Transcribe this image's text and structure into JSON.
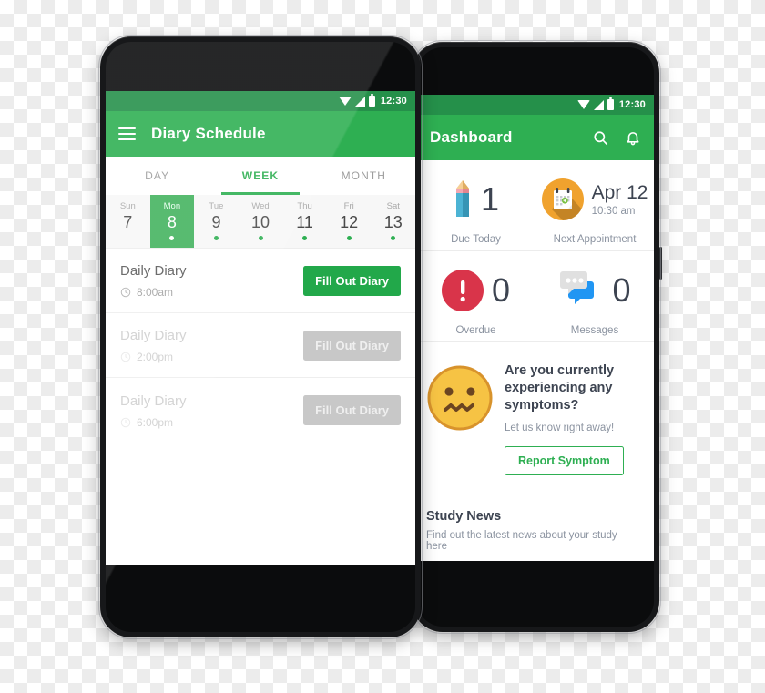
{
  "front_phone": {
    "status_bar": {
      "time": "12:30",
      "icons": [
        "wifi-icon",
        "signal-icon",
        "battery-icon"
      ]
    },
    "app_bar": {
      "menu_icon": "hamburger-menu-icon",
      "title": "Diary Schedule"
    },
    "tabs": [
      {
        "label": "DAY",
        "active": false
      },
      {
        "label": "WEEK",
        "active": true
      },
      {
        "label": "MONTH",
        "active": false
      }
    ],
    "week_strip": [
      {
        "dow": "Sun",
        "num": "7",
        "selected": false,
        "has_dot": false
      },
      {
        "dow": "Mon",
        "num": "8",
        "selected": true,
        "has_dot": true
      },
      {
        "dow": "Tue",
        "num": "9",
        "selected": false,
        "has_dot": true
      },
      {
        "dow": "Wed",
        "num": "10",
        "selected": false,
        "has_dot": true
      },
      {
        "dow": "Thu",
        "num": "11",
        "selected": false,
        "has_dot": true
      },
      {
        "dow": "Fri",
        "num": "12",
        "selected": false,
        "has_dot": true
      },
      {
        "dow": "Sat",
        "num": "13",
        "selected": false,
        "has_dot": true
      }
    ],
    "diary_entries": [
      {
        "title": "Daily Diary",
        "time": "8:00am",
        "button_label": "Fill Out Diary",
        "enabled": true
      },
      {
        "title": "Daily Diary",
        "time": "2:00pm",
        "button_label": "Fill Out Diary",
        "enabled": false
      },
      {
        "title": "Daily Diary",
        "time": "6:00pm",
        "button_label": "Fill Out Diary",
        "enabled": false
      }
    ]
  },
  "back_phone": {
    "status_bar": {
      "time": "12:30",
      "icons": [
        "wifi-icon",
        "signal-icon",
        "battery-icon"
      ]
    },
    "app_bar": {
      "title": "Dashboard",
      "search_icon": "search-icon",
      "notification_icon": "bell-icon"
    },
    "stat_cards": [
      {
        "icon": "pencil-icon",
        "value": "1",
        "label": "Due Today"
      },
      {
        "icon": "calendar-icon",
        "value": "Apr 12",
        "sub_value": "10:30 am",
        "label": "Next Appointment"
      },
      {
        "icon": "alert-icon",
        "value": "0",
        "label": "Overdue"
      },
      {
        "icon": "chat-bubbles-icon",
        "value": "0",
        "label": "Messages"
      }
    ],
    "symptom_card": {
      "emoji": "confounded-face-emoji",
      "question": "Are you currently experiencing any symptoms?",
      "subtitle": "Let us know right away!",
      "button_label": "Report Symptom"
    },
    "news_card": {
      "title": "Study News",
      "subtitle": "Find out the latest news about your study here"
    }
  },
  "theme": {
    "primary_green": "#2eaf52",
    "status_bar_green": "#25904a",
    "button_green": "#22a84a",
    "disabled_gray": "#c8c8c8",
    "text_dark": "#3d4451",
    "text_muted": "#8b93a0",
    "accent_orange": "#f0a22e",
    "accent_red": "#d9344a",
    "accent_blue": "#2196f3"
  }
}
